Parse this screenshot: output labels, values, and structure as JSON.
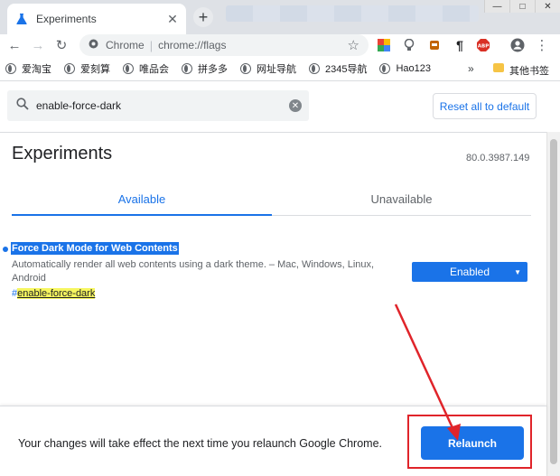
{
  "browser": {
    "tab_title": "Experiments",
    "tab_close": "✕",
    "new_tab": "+",
    "window_controls": {
      "minimize": "—",
      "maximize": "□",
      "close": "✕"
    },
    "icons": [
      "flask-icon",
      "back-icon",
      "forward-icon",
      "reload-icon",
      "star-icon",
      "profile-icon",
      "menu-icon"
    ]
  },
  "toolbar": {
    "site_label": "Chrome",
    "url": "chrome://flags",
    "back": "←",
    "forward": "→",
    "reload": "↻",
    "menu": "⋮",
    "extensions": [
      {
        "name": "color-ext-icon",
        "glyph": "◧",
        "color": "#e8710a"
      },
      {
        "name": "bulb-ext-icon",
        "glyph": "♦",
        "color": "#5f6368"
      },
      {
        "name": "cup-ext-icon",
        "glyph": "▣",
        "color": "#b06000"
      },
      {
        "name": "paragraph-ext-icon",
        "glyph": "¶",
        "color": "#202124"
      },
      {
        "name": "abp-ext-icon",
        "glyph": "ABP",
        "color": "#d93025"
      }
    ]
  },
  "bookmarks": {
    "items": [
      "爱淘宝",
      "爱刻算",
      "唯品会",
      "拼多多",
      "网址导航",
      "2345导航",
      "Hao123"
    ],
    "more": "»",
    "other": "其他书签"
  },
  "search": {
    "value": "enable-force-dark",
    "reset_label": "Reset all to default"
  },
  "page": {
    "title": "Experiments",
    "version": "80.0.3987.149",
    "tabs": [
      {
        "label": "Available",
        "active": true
      },
      {
        "label": "Unavailable",
        "active": false
      }
    ]
  },
  "experiment": {
    "name": "Force Dark Mode for Web Contents",
    "description": "Automatically render all web contents using a dark theme. – Mac, Windows, Linux, Android",
    "link_hash": "#",
    "link_text": "enable-force-dark",
    "selected": "Enabled"
  },
  "footer": {
    "message": "Your changes will take effect the next time you relaunch Google Chrome.",
    "relaunch_label": "Relaunch"
  },
  "colors": {
    "accent": "#1a73e8",
    "annotation": "#e0242a",
    "highlight": "#f6f65f"
  }
}
